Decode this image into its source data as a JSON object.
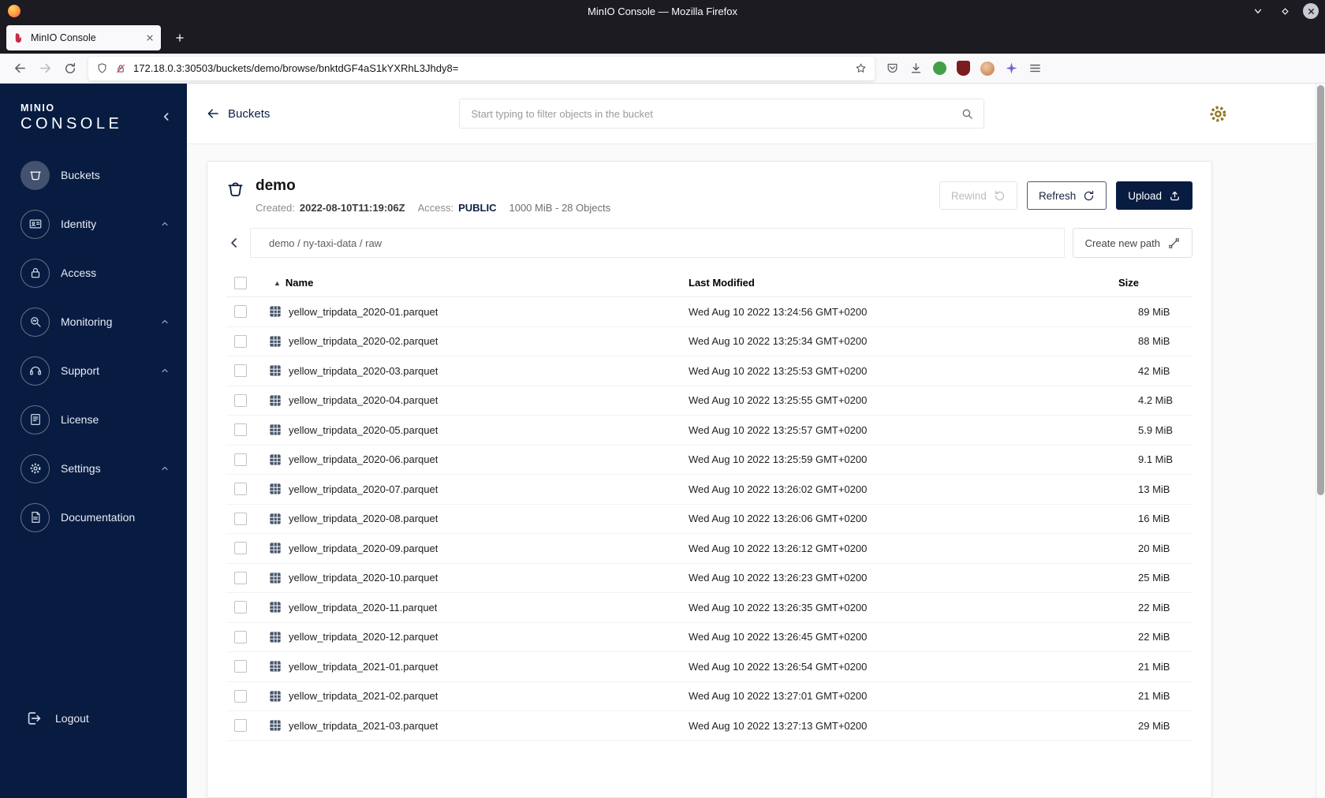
{
  "colors": {
    "sidebar_navy": "#081C42",
    "primary_button_navy": "#081C42",
    "gear_gold": "#8f751d",
    "minio_favicon_red": "#C72C48"
  },
  "browser": {
    "window_title": "MinIO Console — Mozilla Firefox",
    "tab_title": "MinIO Console",
    "url": "172.18.0.3:30503/buckets/demo/browse/bnktdGF4aS1kYXRhL3Jhdy8="
  },
  "sidebar": {
    "logo_top": "MINIO",
    "logo_bottom": "CONSOLE",
    "items": [
      {
        "label": "Buckets",
        "icon": "buckets-icon",
        "active": true
      },
      {
        "label": "Identity",
        "icon": "identity-icon",
        "expandable": true
      },
      {
        "label": "Access",
        "icon": "access-icon"
      },
      {
        "label": "Monitoring",
        "icon": "monitoring-icon",
        "expandable": true
      },
      {
        "label": "Support",
        "icon": "support-icon",
        "expandable": true
      },
      {
        "label": "License",
        "icon": "license-icon"
      },
      {
        "label": "Settings",
        "icon": "settings-icon",
        "expandable": true
      },
      {
        "label": "Documentation",
        "icon": "documentation-icon"
      }
    ],
    "logout_label": "Logout"
  },
  "topbar": {
    "back_label": "Buckets",
    "search_placeholder": "Start typing to filter objects in the bucket"
  },
  "bucket": {
    "name": "demo",
    "created_label": "Created:",
    "created_value": "2022-08-10T11:19:06Z",
    "access_label": "Access:",
    "access_value": "PUBLIC",
    "usage": "1000 MiB - 28 Objects",
    "rewind_label": "Rewind",
    "refresh_label": "Refresh",
    "upload_label": "Upload"
  },
  "path": {
    "display": "demo / ny-taxi-data / raw",
    "create_button_label": "Create new path"
  },
  "table": {
    "name_header": "Name",
    "modified_header": "Last Modified",
    "size_header": "Size",
    "sort_asc_icon": "▲",
    "rows": [
      {
        "name": "yellow_tripdata_2020-01.parquet",
        "modified": "Wed Aug 10 2022 13:24:56 GMT+0200",
        "size": "89 MiB"
      },
      {
        "name": "yellow_tripdata_2020-02.parquet",
        "modified": "Wed Aug 10 2022 13:25:34 GMT+0200",
        "size": "88 MiB"
      },
      {
        "name": "yellow_tripdata_2020-03.parquet",
        "modified": "Wed Aug 10 2022 13:25:53 GMT+0200",
        "size": "42 MiB"
      },
      {
        "name": "yellow_tripdata_2020-04.parquet",
        "modified": "Wed Aug 10 2022 13:25:55 GMT+0200",
        "size": "4.2 MiB"
      },
      {
        "name": "yellow_tripdata_2020-05.parquet",
        "modified": "Wed Aug 10 2022 13:25:57 GMT+0200",
        "size": "5.9 MiB"
      },
      {
        "name": "yellow_tripdata_2020-06.parquet",
        "modified": "Wed Aug 10 2022 13:25:59 GMT+0200",
        "size": "9.1 MiB"
      },
      {
        "name": "yellow_tripdata_2020-07.parquet",
        "modified": "Wed Aug 10 2022 13:26:02 GMT+0200",
        "size": "13 MiB"
      },
      {
        "name": "yellow_tripdata_2020-08.parquet",
        "modified": "Wed Aug 10 2022 13:26:06 GMT+0200",
        "size": "16 MiB"
      },
      {
        "name": "yellow_tripdata_2020-09.parquet",
        "modified": "Wed Aug 10 2022 13:26:12 GMT+0200",
        "size": "20 MiB"
      },
      {
        "name": "yellow_tripdata_2020-10.parquet",
        "modified": "Wed Aug 10 2022 13:26:23 GMT+0200",
        "size": "25 MiB"
      },
      {
        "name": "yellow_tripdata_2020-11.parquet",
        "modified": "Wed Aug 10 2022 13:26:35 GMT+0200",
        "size": "22 MiB"
      },
      {
        "name": "yellow_tripdata_2020-12.parquet",
        "modified": "Wed Aug 10 2022 13:26:45 GMT+0200",
        "size": "22 MiB"
      },
      {
        "name": "yellow_tripdata_2021-01.parquet",
        "modified": "Wed Aug 10 2022 13:26:54 GMT+0200",
        "size": "21 MiB"
      },
      {
        "name": "yellow_tripdata_2021-02.parquet",
        "modified": "Wed Aug 10 2022 13:27:01 GMT+0200",
        "size": "21 MiB"
      },
      {
        "name": "yellow_tripdata_2021-03.parquet",
        "modified": "Wed Aug 10 2022 13:27:13 GMT+0200",
        "size": "29 MiB"
      }
    ]
  }
}
